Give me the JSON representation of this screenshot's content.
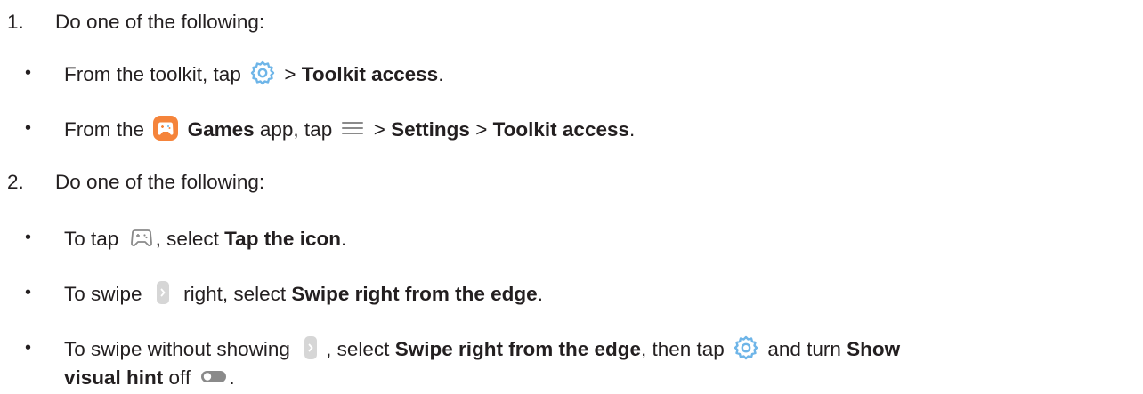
{
  "steps": [
    {
      "number": "1.",
      "text": "Do one of the following:",
      "bullets": [
        {
          "prefix": "From the toolkit, tap",
          "icon": "settings-gear-icon",
          "separator": ">",
          "bold": "Toolkit access",
          "end": "."
        },
        {
          "prefix": "From the",
          "app_icon": "games-app-icon",
          "app_name": "Games",
          "mid": "app, tap",
          "menu_icon": "hamburger-menu-icon",
          "sep1": ">",
          "bold1": "Settings",
          "sep2": ">",
          "bold2": "Toolkit access",
          "end": "."
        }
      ]
    },
    {
      "number": "2.",
      "text": "Do one of the following:",
      "bullets": [
        {
          "prefix": "To tap",
          "icon": "gamepad-icon",
          "mid": ", select",
          "bold": "Tap the icon",
          "end": "."
        },
        {
          "prefix": "To swipe",
          "icon": "edge-handle-icon",
          "mid": "right, select",
          "bold": "Swipe right from the edge",
          "end": "."
        },
        {
          "prefix": "To swipe without showing",
          "icon1": "edge-handle-icon",
          "mid1": ", select",
          "bold1": "Swipe right from the edge",
          "mid2": ", then tap",
          "icon2": "settings-gear-icon",
          "mid3": "and turn",
          "bold2a": "Show",
          "bold2b": "visual hint",
          "mid4": "off",
          "icon3": "toggle-off-icon",
          "end": "."
        }
      ]
    }
  ],
  "bullet_symbol": "•",
  "colors": {
    "text": "#231f20",
    "gear_blue": "#6eb5e8",
    "games_orange": "#f5843b",
    "icon_gray": "#8a8a8a",
    "handle_gray": "#d6d6d6"
  }
}
